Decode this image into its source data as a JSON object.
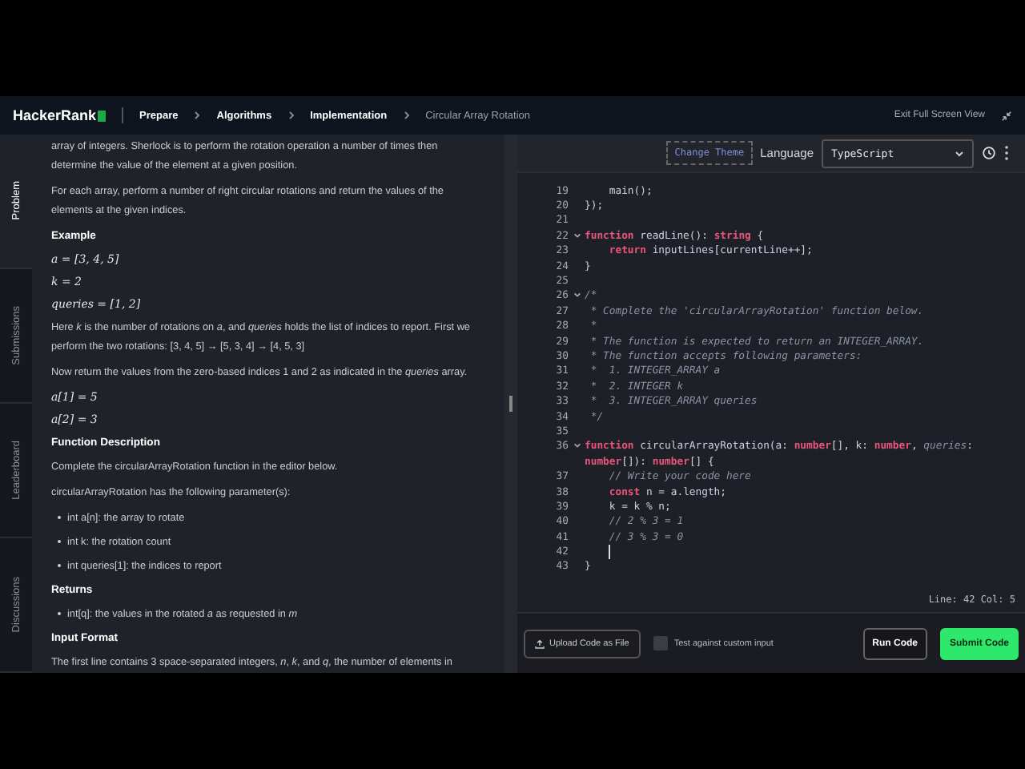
{
  "header": {
    "logo": "HackerRank",
    "breadcrumbs": [
      "Prepare",
      "Algorithms",
      "Implementation",
      "Circular Array Rotation"
    ],
    "exit": "Exit Full Screen View"
  },
  "side_tabs": [
    {
      "label": "Problem",
      "selected": true
    },
    {
      "label": "Submissions",
      "selected": false
    },
    {
      "label": "Leaderboard",
      "selected": false
    },
    {
      "label": "Discussions",
      "selected": false
    }
  ],
  "problem": [
    {
      "kind": "para",
      "text": "array of integers. Sherlock is to perform the rotation operation a number of times then determine the value of the element at a given position."
    },
    {
      "kind": "para",
      "text": "For each array, perform a number of right circular rotations and return the values of the elements at the given indices."
    },
    {
      "kind": "heading",
      "text": "Example"
    },
    {
      "kind": "math",
      "text": "a = [3, 4, 5]"
    },
    {
      "kind": "math",
      "text": "k = 2"
    },
    {
      "kind": "math",
      "text": "queries = [1, 2]"
    },
    {
      "kind": "para",
      "text": "Here *k* is the number of rotations on *a*, and *queries* holds the list of indices to report. First we perform the two rotations: [3, 4, 5] → [5, 3, 4] → [4, 5, 3]"
    },
    {
      "kind": "para",
      "text": "Now return the values from the zero-based indices 1 and 2 as indicated in the *queries* array."
    },
    {
      "kind": "math",
      "text": "a[1] = 5"
    },
    {
      "kind": "math",
      "text": "a[2] = 3"
    },
    {
      "kind": "heading",
      "text": "Function Description"
    },
    {
      "kind": "para",
      "text": "Complete the circularArrayRotation function in the editor below."
    },
    {
      "kind": "para",
      "text": "circularArrayRotation has the following parameter(s):"
    },
    {
      "kind": "bullet",
      "text": "int a[n]: the array to rotate"
    },
    {
      "kind": "bullet",
      "text": "int k: the rotation count"
    },
    {
      "kind": "bullet",
      "text": "int queries[1]: the indices to report"
    },
    {
      "kind": "heading",
      "text": "Returns"
    },
    {
      "kind": "bullet",
      "text": "int[q]: the values in the rotated *a* as requested in *m*"
    },
    {
      "kind": "heading",
      "text": "Input Format"
    },
    {
      "kind": "para",
      "text": "The first line contains 3 space-separated integers, *n*, *k*, and *q*, the number of elements in"
    }
  ],
  "editor": {
    "theme_button": "Change Theme",
    "language_label": "Language",
    "language": "TypeScript",
    "lines": [
      {
        "num": "19",
        "tokens": [
          {
            "kind": "pl",
            "text": "    main();"
          }
        ]
      },
      {
        "num": "20",
        "tokens": [
          {
            "kind": "pl",
            "text": "});"
          }
        ]
      },
      {
        "num": "21"
      },
      {
        "num": "22",
        "fold": true,
        "tokens": [
          {
            "kind": "kw",
            "text": "function"
          },
          {
            "kind": "pl",
            "text": " readLine(): "
          },
          {
            "kind": "kw",
            "text": "string"
          },
          {
            "kind": "pl",
            "text": " {"
          }
        ]
      },
      {
        "num": "23",
        "tokens": [
          {
            "kind": "kw",
            "text": "    return"
          },
          {
            "kind": "pl",
            "text": " inputLines[currentLine++];"
          }
        ]
      },
      {
        "num": "24",
        "tokens": [
          {
            "kind": "pl",
            "text": "}"
          }
        ]
      },
      {
        "num": "25"
      },
      {
        "num": "26",
        "fold": true,
        "tokens": [
          {
            "kind": "cm",
            "text": "/*"
          }
        ]
      },
      {
        "num": "27",
        "tokens": [
          {
            "kind": "cm",
            "text": " * Complete the 'circularArrayRotation' function below."
          }
        ]
      },
      {
        "num": "28",
        "tokens": [
          {
            "kind": "cm",
            "text": " *"
          }
        ]
      },
      {
        "num": "29",
        "tokens": [
          {
            "kind": "cm",
            "text": " * The function is expected to return an INTEGER_ARRAY."
          }
        ]
      },
      {
        "num": "30",
        "tokens": [
          {
            "kind": "cm",
            "text": " * The function accepts following parameters:"
          }
        ]
      },
      {
        "num": "31",
        "tokens": [
          {
            "kind": "cm",
            "text": " *  1. INTEGER_ARRAY a"
          }
        ]
      },
      {
        "num": "32",
        "tokens": [
          {
            "kind": "cm",
            "text": " *  2. INTEGER k"
          }
        ]
      },
      {
        "num": "33",
        "tokens": [
          {
            "kind": "cm",
            "text": " *  3. INTEGER_ARRAY queries"
          }
        ]
      },
      {
        "num": "34",
        "tokens": [
          {
            "kind": "cm",
            "text": " */"
          }
        ]
      },
      {
        "num": "35"
      },
      {
        "num": "36",
        "fold": true,
        "tokens": [
          {
            "kind": "kw",
            "text": "function"
          },
          {
            "kind": "pl",
            "text": " circularArrayRotation(a: "
          },
          {
            "kind": "kw",
            "text": "number"
          },
          {
            "kind": "pl",
            "text": "[], k: "
          },
          {
            "kind": "kw",
            "text": "number"
          },
          {
            "kind": "pl",
            "text": ", "
          },
          {
            "kind": "cm",
            "text": "queries"
          },
          {
            "kind": "pl",
            "text": ":"
          }
        ]
      },
      {
        "tokens": [
          {
            "kind": "kw",
            "text": "number"
          },
          {
            "kind": "pl",
            "text": "[]): "
          },
          {
            "kind": "kw",
            "text": "number"
          },
          {
            "kind": "pl",
            "text": "[] {"
          }
        ]
      },
      {
        "num": "37",
        "tokens": [
          {
            "kind": "cm",
            "text": "    // Write your code here"
          }
        ]
      },
      {
        "num": "38",
        "tokens": [
          {
            "kind": "kw",
            "text": "    const"
          },
          {
            "kind": "pl",
            "text": " n = a.length;"
          }
        ]
      },
      {
        "num": "39",
        "tokens": [
          {
            "kind": "pl",
            "text": "    k = k % n;"
          }
        ]
      },
      {
        "num": "40",
        "tokens": [
          {
            "kind": "cm",
            "text": "    // 2 % 3 = 1"
          }
        ]
      },
      {
        "num": "41",
        "tokens": [
          {
            "kind": "cm",
            "text": "    // 3 % 3 = 0"
          }
        ]
      },
      {
        "num": "42",
        "cursor": true
      },
      {
        "num": "43",
        "tokens": [
          {
            "kind": "pl",
            "text": "}"
          }
        ]
      }
    ],
    "status": "Line: 42 Col: 5"
  },
  "footer": {
    "upload": "Upload Code as File",
    "custom_input": {
      "label": "Test against custom input",
      "checked": false
    },
    "run": "Run Code",
    "submit": "Submit Code"
  }
}
